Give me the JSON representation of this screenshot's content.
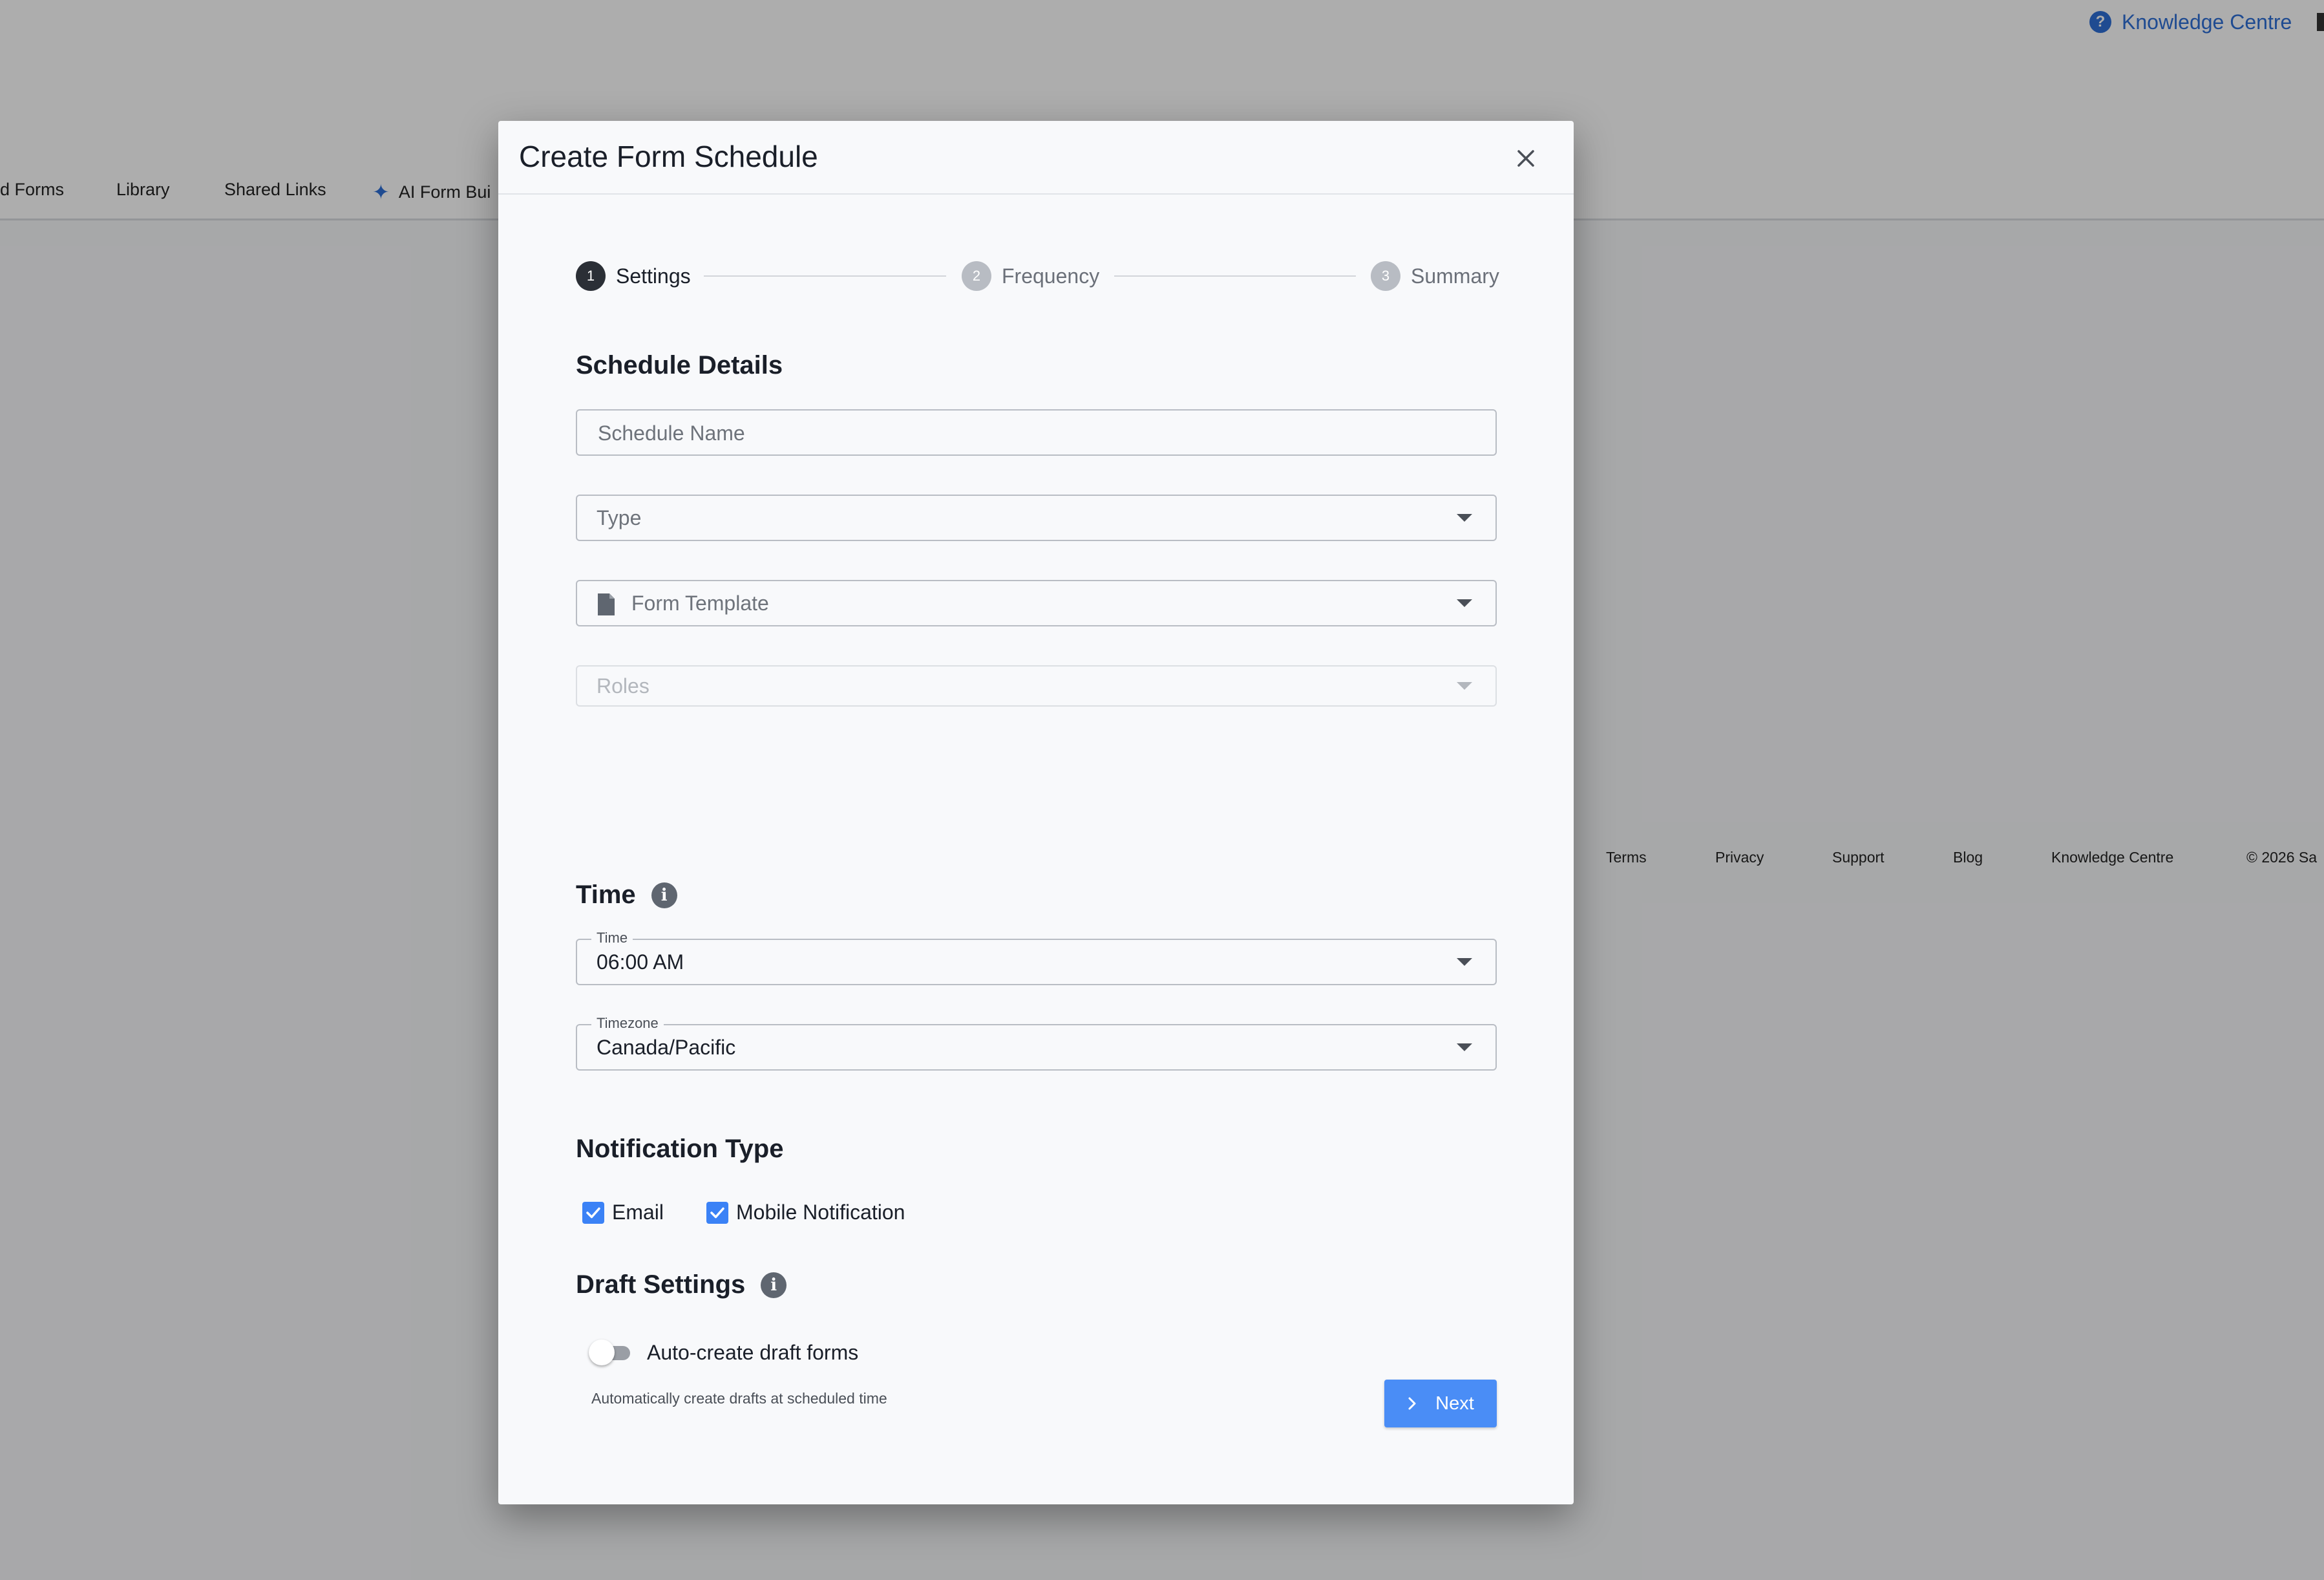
{
  "app": {
    "knowledge_centre_link": "Knowledge Centre",
    "subnav": {
      "items": [
        "d Forms",
        "Library",
        "Shared Links",
        "AI Form Bui"
      ]
    },
    "footer": {
      "links": [
        "Terms",
        "Privacy",
        "Support",
        "Blog",
        "Knowledge Centre",
        "© 2026 Sa"
      ]
    }
  },
  "modal": {
    "title": "Create Form Schedule",
    "close_label": "×",
    "stepper": {
      "steps": [
        {
          "number": "1",
          "label": "Settings",
          "state": "active"
        },
        {
          "number": "2",
          "label": "Frequency",
          "state": "inactive"
        },
        {
          "number": "3",
          "label": "Summary",
          "state": "inactive"
        }
      ]
    },
    "schedule_details": {
      "heading": "Schedule Details",
      "schedule_name_placeholder": "Schedule Name",
      "type_placeholder": "Type",
      "form_template_placeholder": "Form Template",
      "roles_placeholder": "Roles"
    },
    "time_section": {
      "heading": "Time",
      "time_label": "Time",
      "time_value": "06:00 AM",
      "timezone_label": "Timezone",
      "timezone_value": "Canada/Pacific"
    },
    "notification_type": {
      "heading": "Notification Type",
      "options": [
        {
          "label": "Email",
          "checked": true
        },
        {
          "label": "Mobile Notification",
          "checked": true
        }
      ]
    },
    "draft_settings": {
      "heading": "Draft Settings",
      "toggle_label": "Auto-create draft forms",
      "toggle_on": false,
      "helper_text": "Automatically create drafts at scheduled time"
    },
    "next_button_label": "Next"
  },
  "colors": {
    "primary": "#4a8df6",
    "link": "#2f6fd6",
    "checkbox": "#3b82f6",
    "active_step": "#2b2f36",
    "inactive_step": "#b8bcc3"
  }
}
